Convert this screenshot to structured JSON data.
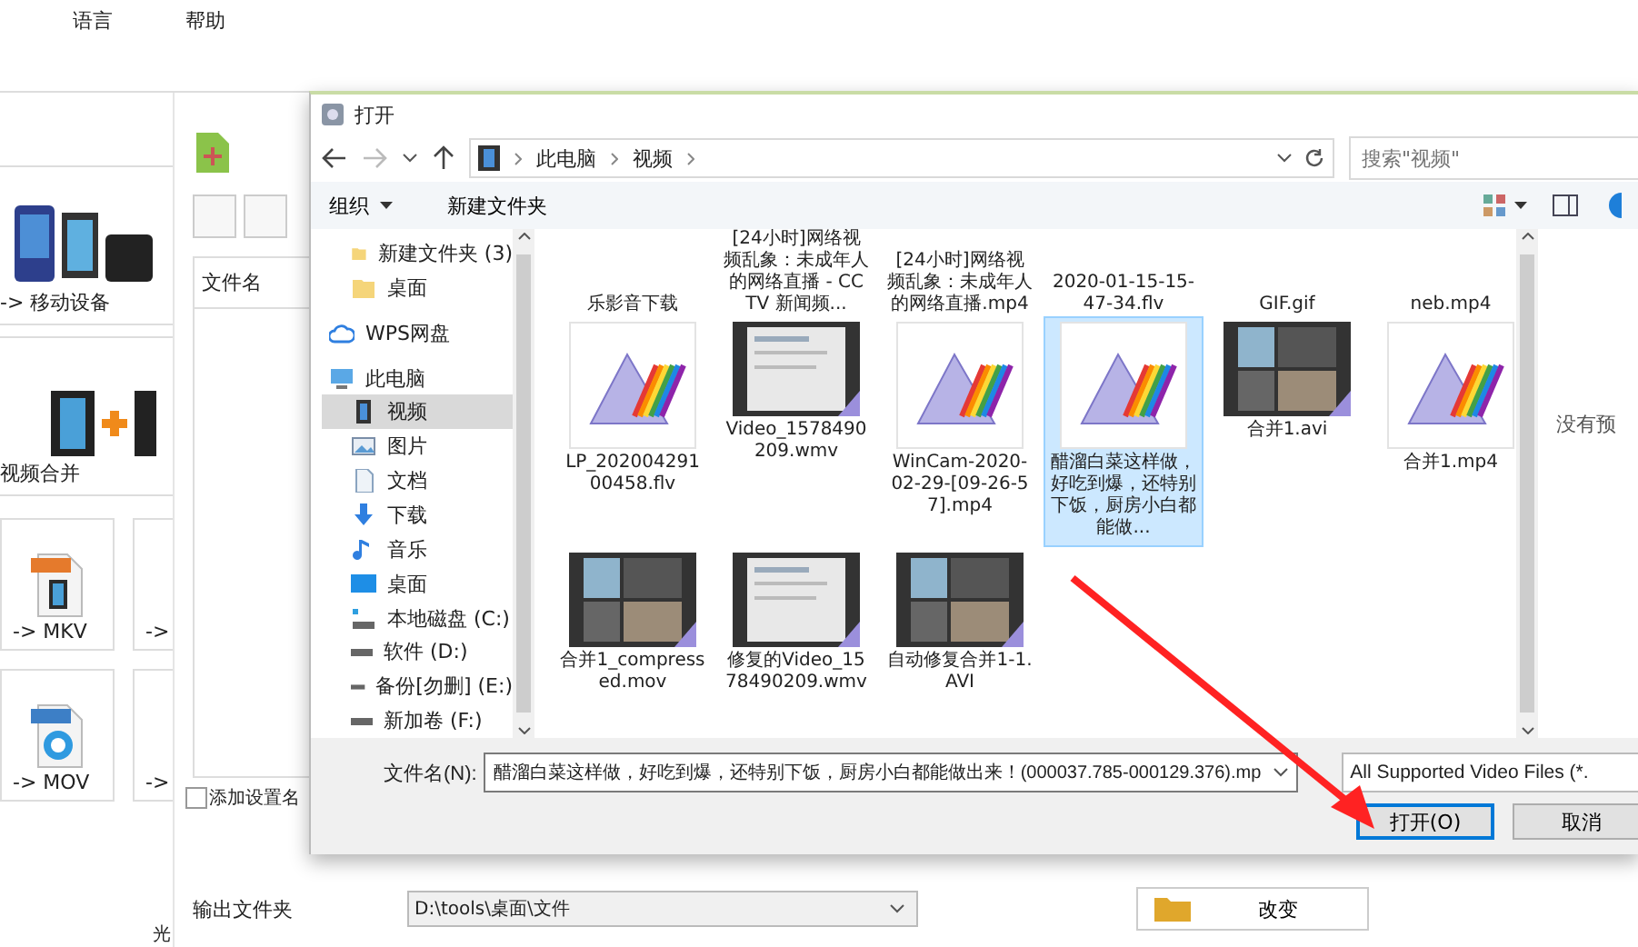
{
  "background_app": {
    "menu": [
      "语言",
      "帮助"
    ],
    "profile_cards": [
      {
        "label": "-> 移动设备",
        "kind": "devices"
      },
      {
        "label": "视频合并",
        "kind": "merge"
      }
    ],
    "format_tiles": [
      {
        "label": "-> MKV",
        "kind": "mkv"
      },
      {
        "label": "->",
        "kind": "blank"
      },
      {
        "label": "-> MOV",
        "kind": "mov"
      },
      {
        "label": "->",
        "kind": "blank"
      }
    ],
    "file_list": {
      "columns": [
        "文件名"
      ]
    },
    "add_setting_name": {
      "label": "添加设置名",
      "checked": false
    },
    "output_folder": {
      "label": "输出文件夹",
      "value": "D:\\tools\\桌面\\文件",
      "change_button": "改变"
    },
    "status": "光"
  },
  "dialog": {
    "title": "打开",
    "breadcrumb": [
      "此电脑",
      "视频"
    ],
    "search": {
      "placeholder": "搜索\"视频\""
    },
    "toolbar": {
      "organize": "组织",
      "new_folder": "新建文件夹"
    },
    "nav_tree_top": [
      {
        "label": "新建文件夹 (3)",
        "kind": "folder",
        "selected": false
      },
      {
        "label": "桌面",
        "kind": "folder",
        "selected": false
      }
    ],
    "nav_tree": [
      {
        "label": "WPS网盘",
        "kind": "cloud",
        "selected": false
      },
      {
        "label": "此电脑",
        "kind": "computer",
        "selected": false,
        "children": [
          {
            "label": "视频",
            "kind": "videos",
            "selected": true
          },
          {
            "label": "图片",
            "kind": "pictures",
            "selected": false
          },
          {
            "label": "文档",
            "kind": "documents",
            "selected": false
          },
          {
            "label": "下载",
            "kind": "downloads",
            "selected": false
          },
          {
            "label": "音乐",
            "kind": "music",
            "selected": false
          },
          {
            "label": "桌面",
            "kind": "desktop",
            "selected": false
          },
          {
            "label": "本地磁盘 (C:)",
            "kind": "system_drive",
            "selected": false
          },
          {
            "label": "软件 (D:)",
            "kind": "drive",
            "selected": false
          },
          {
            "label": "备份[勿删] (E:)",
            "kind": "drive",
            "selected": false
          },
          {
            "label": "新加卷 (F:)",
            "kind": "drive",
            "selected": false
          }
        ]
      }
    ],
    "files_partial": [
      "乐影音下载",
      "[24小时]网络视频乱象：未成年人的网络直播 - CCTV 新闻频...",
      "[24小时]网络视频乱象：未成年人的网络直播.mp4",
      "2020-01-15-15-47-34.flv",
      "GIF.gif",
      "neb.mp4"
    ],
    "files": [
      {
        "name": "LP_20200429100458.flv",
        "kind": "prism",
        "selected": false
      },
      {
        "name": "Video_1578490209.wmv",
        "kind": "screen",
        "selected": false
      },
      {
        "name": "WinCam-2020-02-29-[09-26-57].mp4",
        "kind": "prism",
        "selected": false
      },
      {
        "name": "醋溜白菜这样做，好吃到爆，还特别下饭，厨房小白都能做...",
        "kind": "prism",
        "selected": true
      },
      {
        "name": "合并1.avi",
        "kind": "desk",
        "selected": false
      },
      {
        "name": "合并1.mp4",
        "kind": "prism",
        "selected": false
      },
      {
        "name": "合并1_compressed.mov",
        "kind": "desk",
        "selected": false
      },
      {
        "name": "修复的Video_1578490209.wmv",
        "kind": "screen",
        "selected": false
      },
      {
        "name": "自动修复合并1-1.AVI",
        "kind": "desk",
        "selected": false
      }
    ],
    "preview": "没有预",
    "filename": {
      "label": "文件名(N):",
      "value": "醋溜白菜这样做，好吃到爆，还特别下饭，厨房小白都能做出来！(000037.785-000129.376).mp"
    },
    "file_type": "All Supported Video Files (*.",
    "buttons": [
      {
        "label": "打开(O)",
        "default": true
      },
      {
        "label": "取消",
        "default": false
      }
    ]
  }
}
